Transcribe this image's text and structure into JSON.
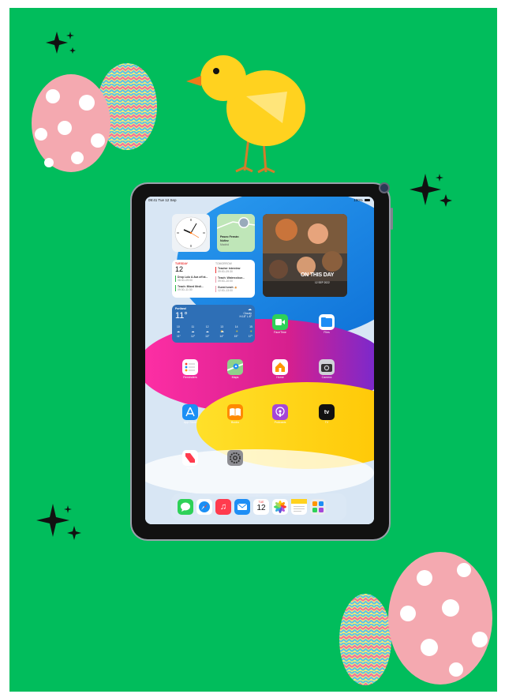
{
  "status": {
    "time": "09:41 Tue 12 Sep",
    "battery": "100%"
  },
  "contact": {
    "line1": "Paseo Fernán",
    "line2": "Núñez",
    "line3": "Madrid"
  },
  "photo": {
    "title": "ON THIS DAY",
    "date": "12 SEP 2022"
  },
  "calendar": {
    "left_header": "TUESDAY",
    "day": "12",
    "right_header": "TOMORROW",
    "events": [
      {
        "title": "Teacher interview",
        "time": "09:00–09:30"
      },
      {
        "title": "Teach: Watercolour...",
        "time": "09:00–10:00"
      },
      {
        "title": "Guest lunch 🍝",
        "time": "12:00–13:00"
      }
    ],
    "left_events": [
      {
        "title": "Drop Lulu & Ava off at...",
        "time": "08:30–09:00"
      },
      {
        "title": "Teach: Mixed Medi...",
        "time": "09:30–11:30"
      }
    ]
  },
  "weather": {
    "city": "Portland",
    "temp": "11°",
    "condition": "Cloudy",
    "hilo": "H:18° L:8°",
    "hours": [
      "10",
      "11",
      "12",
      "13",
      "14",
      "15"
    ],
    "temps": [
      "11°",
      "12°",
      "13°",
      "14°",
      "15°",
      "17°"
    ]
  },
  "apps": {
    "facetime": "FaceTime",
    "files": "Files",
    "reminders": "Reminders",
    "maps": "Maps",
    "home": "Home",
    "camera": "Camera",
    "appstore": "App Store",
    "books": "Books",
    "podcasts": "Podcasts",
    "tv": "TV",
    "news": "News",
    "settings": "Settings"
  },
  "dock": {
    "calendar_day": "TUE",
    "calendar_date": "12"
  },
  "colors": {
    "background": "#01bd5c",
    "egg_pink": "#f4a9b0",
    "egg_yellow": "#f9ee72",
    "chick_yellow": "#ffd21f"
  }
}
